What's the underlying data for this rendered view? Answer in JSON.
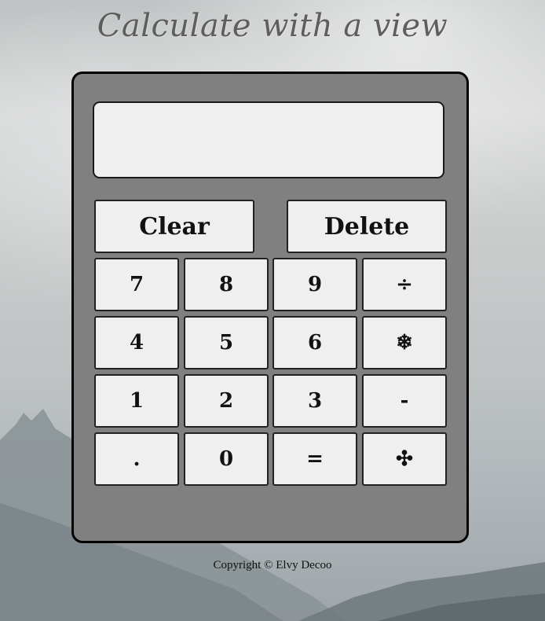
{
  "header": {
    "title": "Calculate with a view"
  },
  "calculator": {
    "display_value": "",
    "clear_label": "Clear",
    "delete_label": "Delete",
    "keys": [
      {
        "label": "7",
        "name": "key-7"
      },
      {
        "label": "8",
        "name": "key-8"
      },
      {
        "label": "9",
        "name": "key-9"
      },
      {
        "label": "÷",
        "name": "key-divide"
      },
      {
        "label": "4",
        "name": "key-4"
      },
      {
        "label": "5",
        "name": "key-5"
      },
      {
        "label": "6",
        "name": "key-6"
      },
      {
        "label": "❄",
        "name": "key-multiply"
      },
      {
        "label": "1",
        "name": "key-1"
      },
      {
        "label": "2",
        "name": "key-2"
      },
      {
        "label": "3",
        "name": "key-3"
      },
      {
        "label": "-",
        "name": "key-subtract"
      },
      {
        "label": ".",
        "name": "key-decimal"
      },
      {
        "label": "0",
        "name": "key-0"
      },
      {
        "label": "=",
        "name": "key-equals"
      },
      {
        "label": "✣",
        "name": "key-add"
      }
    ]
  },
  "footer": {
    "copyright": "Copyright © Elvy Decoo"
  },
  "colors": {
    "calculator_body": "#808080",
    "button_face": "#efefef",
    "title_text": "#5e5e5e"
  }
}
